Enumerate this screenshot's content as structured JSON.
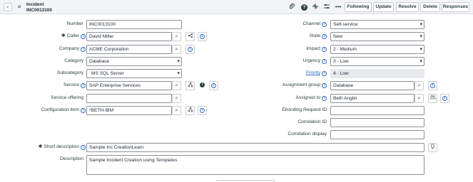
{
  "header": {
    "title": "Incident",
    "number": "INC0013100",
    "buttons": {
      "following": "Following",
      "update": "Update",
      "resolve": "Resolve",
      "delete": "Delete",
      "responses": "Responses"
    }
  },
  "left": {
    "number": {
      "label": "Number",
      "value": "INC0013100"
    },
    "caller": {
      "label": "Caller",
      "value": "David Miller"
    },
    "company": {
      "label": "Company",
      "value": "ACME Corporation"
    },
    "category": {
      "label": "Category",
      "value": "Database"
    },
    "subcategory": {
      "label": "Subcategory",
      "value": "MS SQL Server"
    },
    "service": {
      "label": "Service",
      "value": "SAP Enterprise Services"
    },
    "service_offering": {
      "label": "Service offering",
      "value": ""
    },
    "config_item": {
      "label": "Configuration item",
      "value": "*BETH-IBM"
    }
  },
  "right": {
    "channel": {
      "label": "Channel",
      "value": "Self-service"
    },
    "state": {
      "label": "State",
      "value": "New"
    },
    "impact": {
      "label": "Impact",
      "value": "2 - Medium"
    },
    "urgency": {
      "label": "Urgency",
      "value": "3 - Low"
    },
    "priority": {
      "label": "Priority",
      "value": "4 - Low"
    },
    "assignment_group": {
      "label": "Assignment group",
      "value": "Database"
    },
    "assigned_to": {
      "label": "Assigned to",
      "value": "Beth Anglin"
    },
    "ebonding": {
      "label": "Ebonding Request ID",
      "value": ""
    },
    "correlation_id": {
      "label": "Correlation ID",
      "value": ""
    },
    "correlation_display": {
      "label": "Correlation display",
      "value": ""
    }
  },
  "short_description": {
    "label": "Short description",
    "value": "Sample Inc CreationLearn"
  },
  "description": {
    "label": "Description",
    "value": "Sample Incident Creation using Templates"
  },
  "icons": {
    "help": "?",
    "search": "⌕",
    "info": "i",
    "hierarchy": "⧉",
    "lightbulb": "lightbulb-icon"
  }
}
